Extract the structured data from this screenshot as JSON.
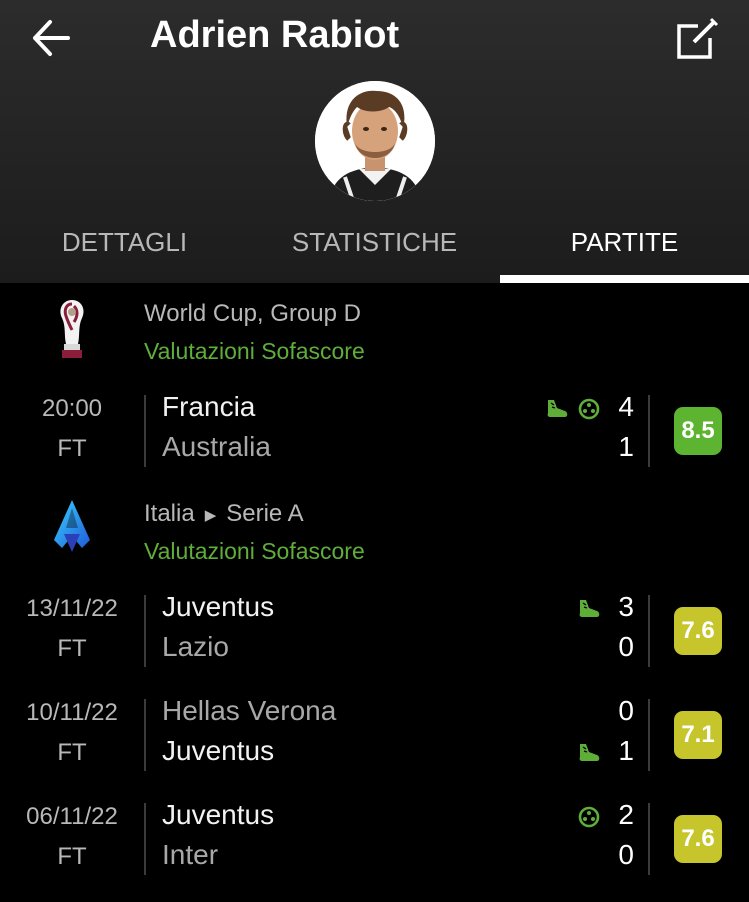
{
  "header": {
    "title": "Adrien Rabiot",
    "tabs": [
      "DETTAGLI",
      "STATISTICHE",
      "PARTITE"
    ],
    "active_tab": "PARTITE"
  },
  "tournaments": [
    {
      "name": "World Cup, Group D",
      "subtitle": "Valutazioni Sofascore",
      "logo": "world-cup-trophy"
    },
    {
      "country": "Italia",
      "league": "Serie A",
      "subtitle": "Valutazioni Sofascore",
      "logo": "serie-a"
    }
  ],
  "matches": [
    {
      "date": "20:00",
      "status": "FT",
      "home": "Francia",
      "away": "Australia",
      "home_score": "4",
      "away_score": "1",
      "rating": "8.5",
      "rating_color": "#5db431",
      "events": [
        "boot-icon",
        "ball-icon"
      ],
      "event_row": "home"
    },
    {
      "date": "13/11/22",
      "status": "FT",
      "home": "Juventus",
      "away": "Lazio",
      "home_score": "3",
      "away_score": "0",
      "rating": "7.6",
      "rating_color": "#c6c52b",
      "events": [
        "boot-icon"
      ],
      "event_row": "home"
    },
    {
      "date": "10/11/22",
      "status": "FT",
      "home": "Hellas Verona",
      "away": "Juventus",
      "home_score": "0",
      "away_score": "1",
      "rating": "7.1",
      "rating_color": "#c6c52b",
      "events": [
        "boot-icon"
      ],
      "event_row": "away"
    },
    {
      "date": "06/11/22",
      "status": "FT",
      "home": "Juventus",
      "away": "Inter",
      "home_score": "2",
      "away_score": "0",
      "rating": "7.6",
      "rating_color": "#c6c52b",
      "events": [
        "ball-icon"
      ],
      "event_row": "home"
    }
  ],
  "colors": {
    "accent_green": "#5fae3a",
    "rating_high": "#5db431",
    "rating_mid": "#c6c52b"
  }
}
